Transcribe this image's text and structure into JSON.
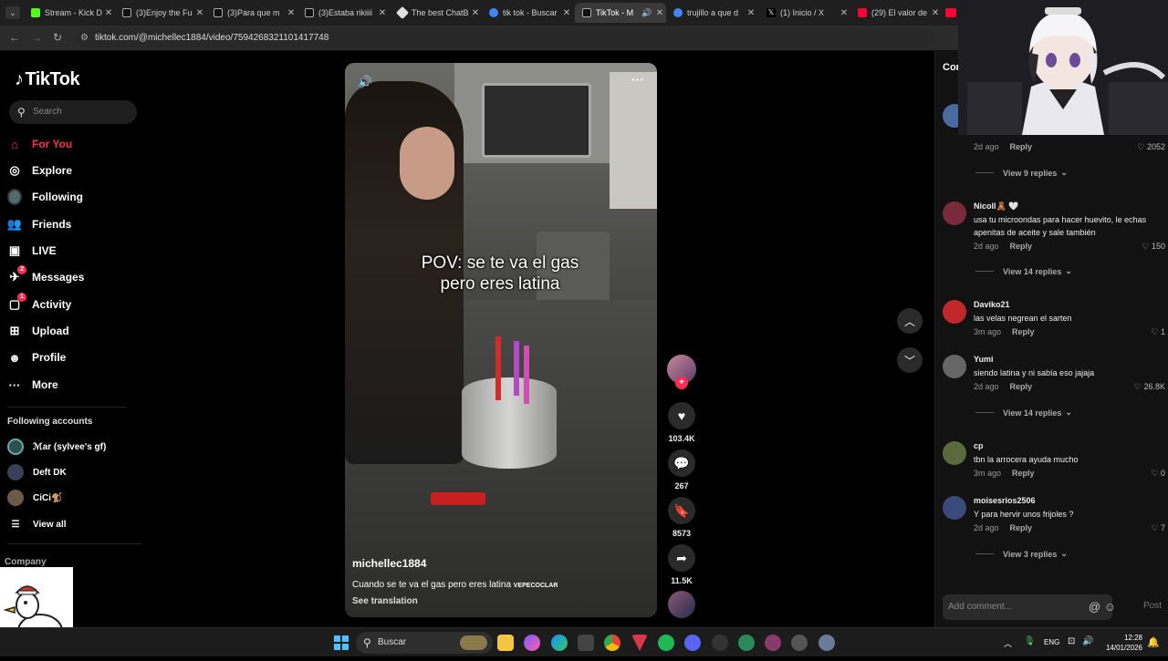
{
  "browser": {
    "tabs": [
      {
        "title": "Stream - Kick D",
        "color": "#53fc18"
      },
      {
        "title": "(3)Enjoy the Fu",
        "color": "#ffffff"
      },
      {
        "title": "(3)Para que m",
        "color": "#ffffff"
      },
      {
        "title": "(3)Estaba rikiiii",
        "color": "#ffffff"
      },
      {
        "title": "The best ChatB",
        "color": "#e0e0e0"
      },
      {
        "title": "tik tok - Buscar",
        "color": "#4285f4"
      },
      {
        "title": "TikTok - M",
        "color": "#ffffff"
      },
      {
        "title": "trujillo a que d",
        "color": "#4285f4"
      },
      {
        "title": "(1) Inicio / X",
        "color": "#ffffff"
      },
      {
        "title": "(29) El valor de",
        "color": "#ff0033"
      }
    ],
    "url": "tiktok.com/@michellec1884/video/7594268321101417748"
  },
  "sidebar": {
    "logo": "TikTok",
    "search_placeholder": "Search",
    "nav": [
      {
        "label": "For You",
        "icon": "home-icon"
      },
      {
        "label": "Explore",
        "icon": "compass-icon"
      },
      {
        "label": "Following",
        "icon": "following-icon"
      },
      {
        "label": "Friends",
        "icon": "friends-icon"
      },
      {
        "label": "LIVE",
        "icon": "live-icon"
      },
      {
        "label": "Messages",
        "icon": "messages-icon",
        "badge": "2"
      },
      {
        "label": "Activity",
        "icon": "activity-icon",
        "badge": "1"
      },
      {
        "label": "Upload",
        "icon": "upload-icon"
      },
      {
        "label": "Profile",
        "icon": "profile-icon"
      },
      {
        "label": "More",
        "icon": "more-icon"
      }
    ],
    "following_title": "Following accounts",
    "following": [
      {
        "name": "ℳar (sylvee's gf)"
      },
      {
        "name": "Deft DK"
      },
      {
        "name": "CiCi🐒"
      }
    ],
    "view_all": "View all",
    "company": "Company"
  },
  "video": {
    "overlay_line1": "POV: se te va el gas",
    "overlay_line2": "pero eres latina",
    "author": "michellec1884",
    "caption": "Cuando se te va el gas pero eres latina",
    "caption_tag": "VEPECOCLAR",
    "see_translation": "See translation",
    "likes": "103.4K",
    "comments": "267",
    "saves": "8573",
    "shares": "11.5K"
  },
  "comments_panel": {
    "title": "Com",
    "items": [
      {
        "meta": "2d ago",
        "reply": "Reply",
        "likes": "2052",
        "view_replies": "View 9 replies"
      },
      {
        "user": "Nicoll🧸 🤍",
        "text": "usa tu microondas para hacer huevito, le echas apenitas de aceite y sale también",
        "meta": "2d ago",
        "reply": "Reply",
        "likes": "150",
        "view_replies": "View 14 replies"
      },
      {
        "user": "Daviko21",
        "text": "las velas negrean el sarten",
        "meta": "3m ago",
        "reply": "Reply",
        "likes": "1"
      },
      {
        "user": "Yumi",
        "text": "siendo latina y ni sabía eso jajaja",
        "meta": "2d ago",
        "reply": "Reply",
        "likes": "26.8K",
        "view_replies": "View 14 replies"
      },
      {
        "user": "cp",
        "text": "tbn la arrocera ayuda mucho",
        "meta": "3m ago",
        "reply": "Reply",
        "likes": "0"
      },
      {
        "user": "moisesrios2506",
        "text": "Y para hervir unos frijoles ?",
        "meta": "2d ago",
        "reply": "Reply",
        "likes": "7",
        "view_replies": "View 3 replies"
      }
    ],
    "add_comment_placeholder": "Add comment...",
    "post": "Post"
  },
  "taskbar": {
    "search": "Buscar",
    "lang": "ENG",
    "time": "12:28",
    "date": "14/01/2026"
  }
}
